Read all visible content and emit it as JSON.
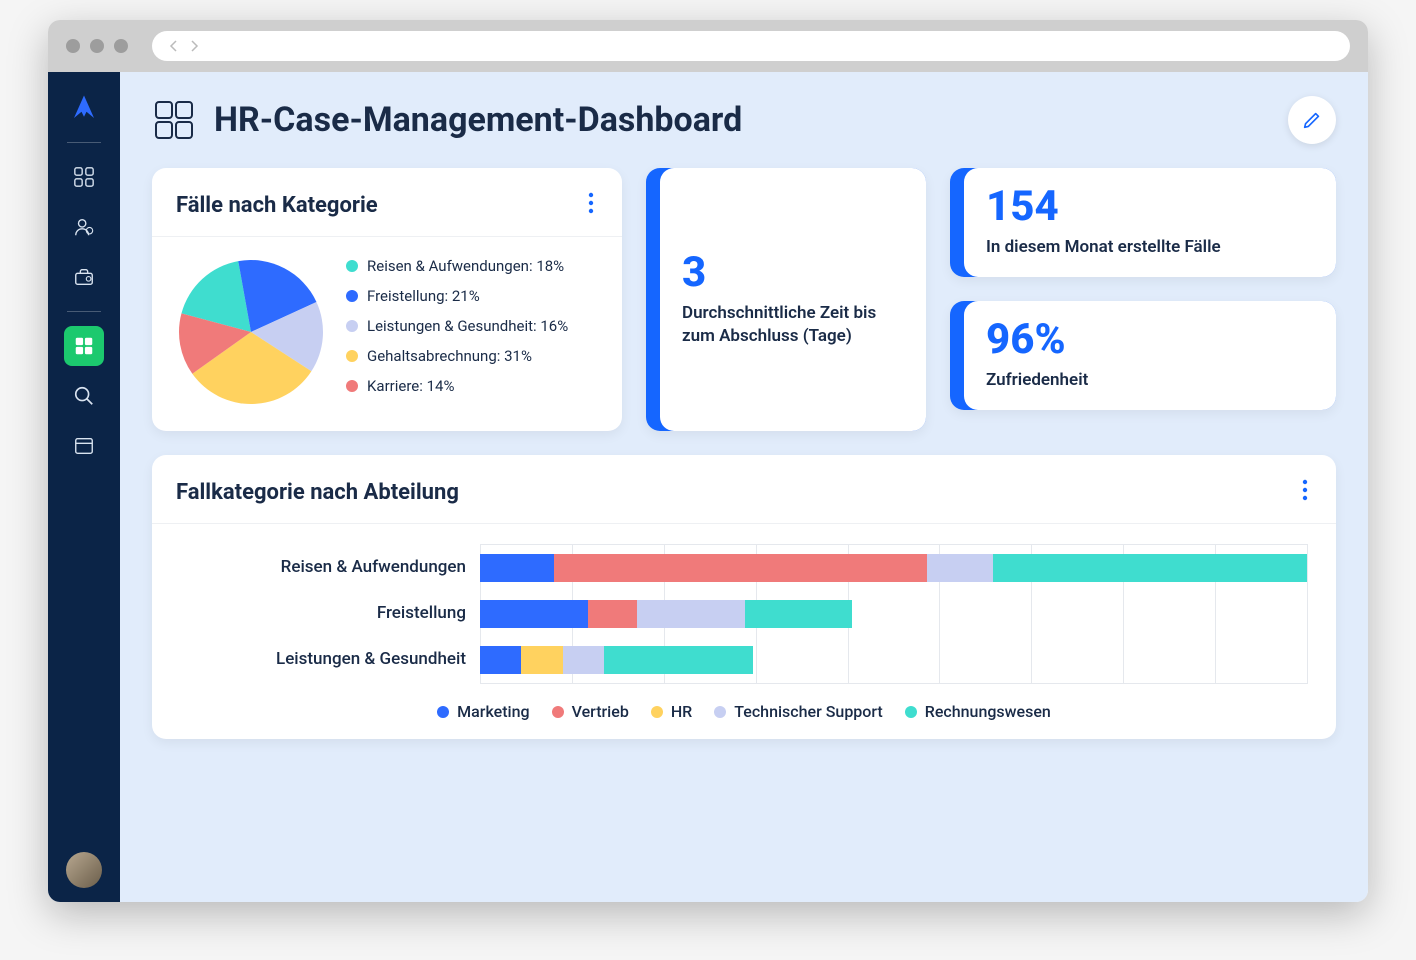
{
  "colors": {
    "blue": "#2e6bff",
    "red": "#f07a7a",
    "yellow": "#ffd25f",
    "lavender": "#c7cff2",
    "teal": "#3fddcf",
    "navy": "#0b2447",
    "accent": "#1566ff"
  },
  "page": {
    "title": "HR-Case-Management-Dashboard"
  },
  "pie_card": {
    "title": "Fälle nach Kategorie"
  },
  "stats": {
    "avg_days": {
      "value": "3",
      "label": "Durchschnittliche Zeit bis zum Abschluss (Tage)"
    },
    "created": {
      "value": "154",
      "label": "In diesem Monat erstellte Fälle"
    },
    "satisfaction": {
      "value": "96%",
      "label": "Zufriedenheit"
    }
  },
  "bar_card": {
    "title": "Fallkategorie nach Abteilung"
  },
  "chart_data": [
    {
      "type": "pie",
      "title": "Fälle nach Kategorie",
      "series": [
        {
          "name": "Reisen & Aufwendungen",
          "value": 18,
          "color": "#3fddcf",
          "label": "Reisen & Aufwendungen: 18%"
        },
        {
          "name": "Freistellung",
          "value": 21,
          "color": "#2e6bff",
          "label": "Freistellung: 21%"
        },
        {
          "name": "Leistungen & Gesundheit",
          "value": 16,
          "color": "#c7cff2",
          "label": "Leistungen & Gesundheit: 16%"
        },
        {
          "name": "Gehaltsabrechnung",
          "value": 31,
          "color": "#ffd25f",
          "label": "Gehaltsabrechnung: 31%"
        },
        {
          "name": "Karriere",
          "value": 14,
          "color": "#f07a7a",
          "label": "Karriere: 14%"
        }
      ]
    },
    {
      "type": "bar",
      "orientation": "horizontal",
      "stacked": true,
      "title": "Fallkategorie nach Abteilung",
      "categories": [
        "Reisen & Aufwendungen",
        "Freistellung",
        "Leistungen & Gesundheit"
      ],
      "series": [
        {
          "name": "Marketing",
          "color": "#2e6bff",
          "values": [
            9,
            13,
            5
          ]
        },
        {
          "name": "Vertrieb",
          "color": "#f07a7a",
          "values": [
            45,
            6,
            0
          ]
        },
        {
          "name": "HR",
          "color": "#ffd25f",
          "values": [
            0,
            0,
            5
          ]
        },
        {
          "name": "Technischer Support",
          "color": "#c7cff2",
          "values": [
            8,
            13,
            5
          ]
        },
        {
          "name": "Rechnungswesen",
          "color": "#3fddcf",
          "values": [
            38,
            13,
            18
          ]
        }
      ],
      "xlim": [
        0,
        100
      ],
      "grid_ticks": 9,
      "legend_labels": [
        "Marketing",
        "Vertrieb",
        "HR",
        "Technischer Support",
        "Rechnungswesen"
      ]
    }
  ]
}
